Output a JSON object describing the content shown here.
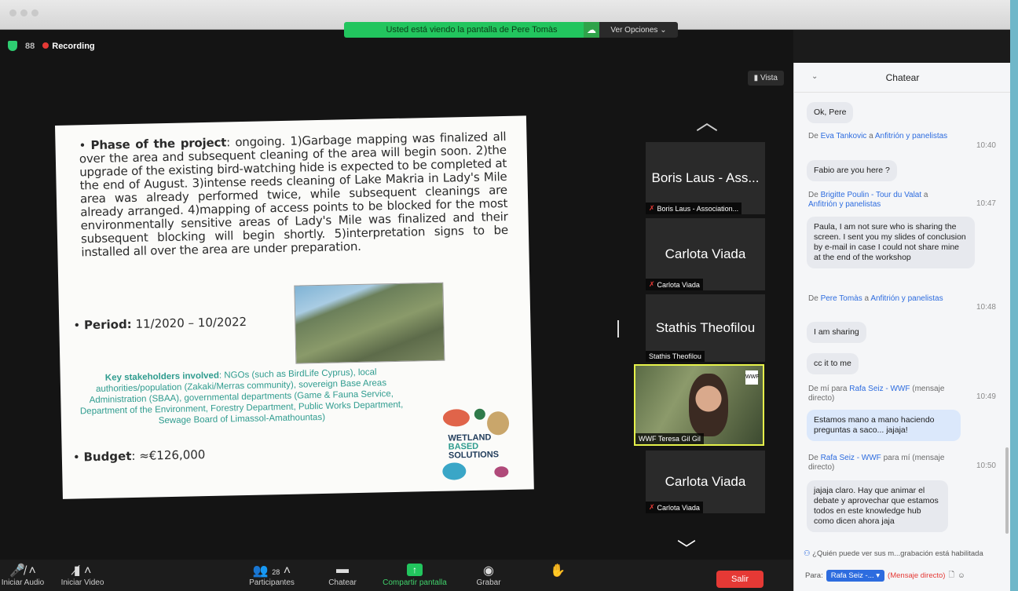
{
  "window": {
    "share_banner": "Usted está viendo la pantalla de Pere Tomàs",
    "view_options": "Ver Opciones ⌄"
  },
  "topbar": {
    "grid_glyph": "88",
    "recording_label": "Recording",
    "vista_label": "Vista"
  },
  "slide": {
    "phase_title": "Phase of the project",
    "phase_text": ": ongoing. 1)Garbage mapping was finalized all over the area and subsequent cleaning of the area will begin soon. 2)the upgrade of the existing bird-watching hide is expected to be completed at the end of August. 3)intense reeds cleaning of Lake Makria in Lady's Mile area was already performed twice, while subsequent cleanings are already arranged. 4)mapping of access points to be blocked for the most environmentally sensitive areas of Lady's Mile was finalized and their subsequent blocking will begin shortly. 5)interpretation signs to be installed all over the area are under preparation.",
    "period_label": "Period:",
    "period_value": " 11/2020 – 10/2022",
    "stake_label": "Key stakeholders involved",
    "stake_text": ": NGOs (such as BirdLife Cyprus), local authorities/population (Zakaki/Merras community), sovereign Base Areas Administration (SBAA), governmental departments (Game & Fauna Service, Department of the Environment, Forestry Department, Public Works Department, Sewage Board of Limassol-Amathountas)",
    "budget_label": "Budget",
    "budget_value": ": ≈€126,000",
    "logo_line1": "WETLAND",
    "logo_line2": "BASED",
    "logo_line3": "SOLUTIONS"
  },
  "participants": [
    {
      "display": "Boris Laus - Ass...",
      "name": "Boris Laus - Association..."
    },
    {
      "display": "Carlota Viada",
      "name": "Carlota Viada"
    },
    {
      "display": "Stathis Theofilou",
      "name": "Stathis Theofilou"
    },
    {
      "display": "",
      "name": "WWF Teresa Gil Gil"
    },
    {
      "display": "Carlota Viada",
      "name": "Carlota Viada"
    }
  ],
  "toolbar": {
    "audio": "Iniciar Audio",
    "video": "Iniciar Video",
    "participants": "Participantes",
    "participants_count": "28",
    "chat": "Chatear",
    "share": "Compartir pantalla",
    "record": "Grabar",
    "leave": "Salir"
  },
  "chat": {
    "title": "Chatear",
    "messages": [
      {
        "meta_pre": "",
        "from": "",
        "mid": "",
        "to": "",
        "time": "",
        "text": "Ok, Pere"
      },
      {
        "meta_pre": "De ",
        "from": "Eva Tankovic",
        "mid": " a ",
        "to": "Anfitrión y panelistas",
        "time": "10:40",
        "text": "Fabio are you here ?"
      },
      {
        "meta_pre": "De ",
        "from": "Brigitte Poulin - Tour du Valat",
        "mid": " a ",
        "to": "Anfitrión y panelistas",
        "time": "10:47",
        "text": "Paula, I am not sure who is sharing the screen. I sent you my slides of conclusion by e-mail in case I could not share mine at the end of the workshop"
      },
      {
        "meta_pre": "De ",
        "from": "Pere Tomàs",
        "mid": " a ",
        "to": "Anfitrión y panelistas",
        "time": "10:48",
        "text": "I am sharing"
      },
      {
        "meta_pre": "",
        "from": "",
        "mid": "",
        "to": "",
        "time": "",
        "text": "cc it to me"
      },
      {
        "meta_pre": "De mí para ",
        "from": "Rafa Seiz - WWF",
        "mid": " (mensaje directo)",
        "to": "",
        "time": "10:49",
        "text": "Estamos mano a mano haciendo preguntas a saco... jajaja!"
      },
      {
        "meta_pre": "De ",
        "from": "Rafa Seiz - WWF",
        "mid": " para mí (mensaje directo)",
        "to": "",
        "time": "10:50",
        "text": "jajaja claro. Hay que animar el debate y aprovechar que estamos todos en este knowledge hub como dicen ahora jaja"
      }
    ],
    "footer_note": "¿Quién puede ver sus m...grabación está habilitada",
    "to_label": "Para:",
    "to_pill": "Rafa Seiz -... ▾",
    "dm_label": "(Mensaje directo)"
  }
}
